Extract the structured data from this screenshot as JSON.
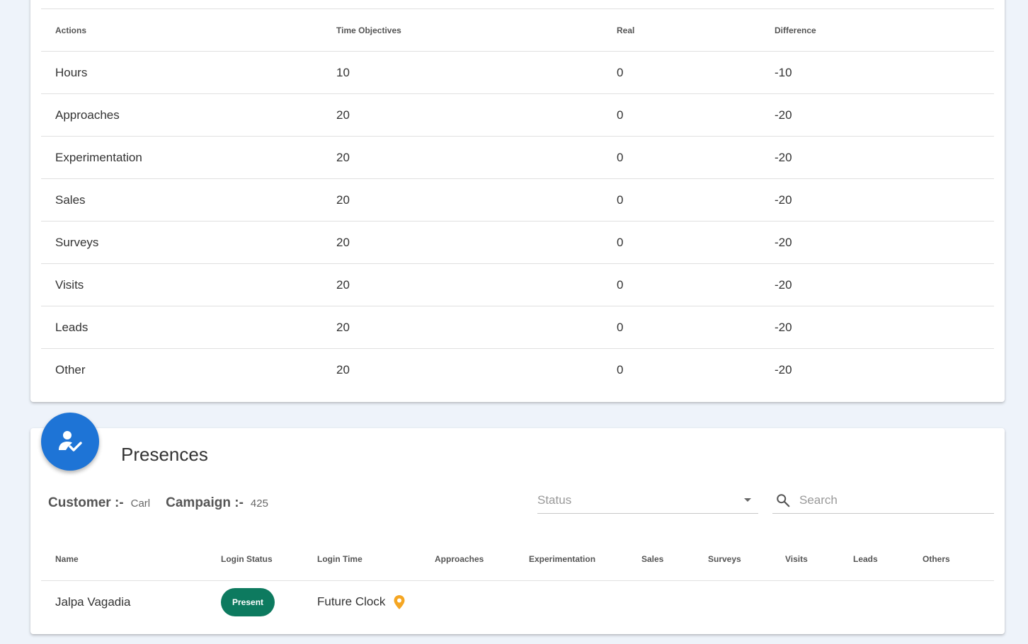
{
  "objectives": {
    "columns": [
      "Actions",
      "Time Objectives",
      "Real",
      "Difference"
    ],
    "rows": [
      {
        "action": "Hours",
        "objective": "10",
        "real": "0",
        "difference": "-10"
      },
      {
        "action": "Approaches",
        "objective": "20",
        "real": "0",
        "difference": "-20"
      },
      {
        "action": "Experimentation",
        "objective": "20",
        "real": "0",
        "difference": "-20"
      },
      {
        "action": "Sales",
        "objective": "20",
        "real": "0",
        "difference": "-20"
      },
      {
        "action": "Surveys",
        "objective": "20",
        "real": "0",
        "difference": "-20"
      },
      {
        "action": "Visits",
        "objective": "20",
        "real": "0",
        "difference": "-20"
      },
      {
        "action": "Leads",
        "objective": "20",
        "real": "0",
        "difference": "-20"
      },
      {
        "action": "Other",
        "objective": "20",
        "real": "0",
        "difference": "-20"
      }
    ]
  },
  "presences": {
    "title": "Presences",
    "icon": "person-check-icon",
    "customer_label": "Customer :-",
    "customer_value": "Carl",
    "campaign_label": "Campaign :-",
    "campaign_value": "425",
    "status_placeholder": "Status",
    "search_placeholder": "Search",
    "columns": [
      "Name",
      "Login Status",
      "Login Time",
      "Approaches",
      "Experimentation",
      "Sales",
      "Surveys",
      "Visits",
      "Leads",
      "Others"
    ],
    "rows": [
      {
        "name": "Jalpa Vagadia",
        "login_status": "Present",
        "login_time": "Future Clock",
        "approaches": "",
        "experimentation": "",
        "sales": "",
        "surveys": "",
        "visits": "",
        "leads": "",
        "others": ""
      }
    ]
  },
  "colors": {
    "accent": "#1e74d6",
    "present_badge": "#0d7a5f",
    "location_pin": "#f5a623"
  }
}
